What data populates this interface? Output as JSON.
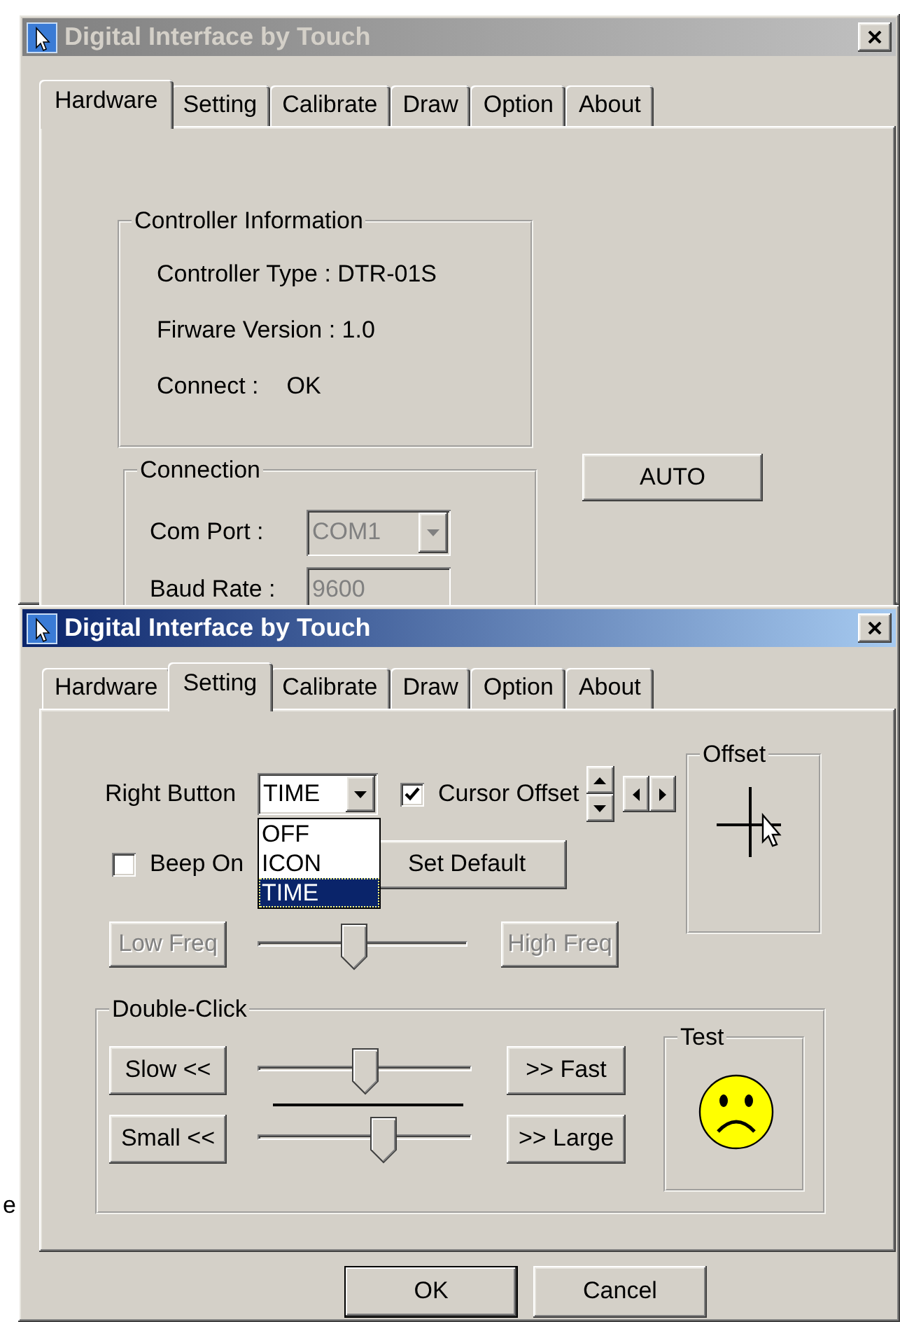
{
  "background_text": "e",
  "windows": [
    {
      "title": "Digital Interface by Touch",
      "active": false,
      "tabs": [
        {
          "label": "Hardware",
          "selected": true
        },
        {
          "label": "Setting",
          "selected": false
        },
        {
          "label": "Calibrate",
          "selected": false
        },
        {
          "label": "Draw",
          "selected": false
        },
        {
          "label": "Option",
          "selected": false
        },
        {
          "label": "About",
          "selected": false
        }
      ],
      "page": {
        "kind": "hardware",
        "controller_info": {
          "title": "Controller Information",
          "lines": [
            {
              "label": "Controller Type : DTR-01S"
            },
            {
              "label": "Firware Version : 1.0"
            },
            {
              "label": "Connect :",
              "value": "OK"
            }
          ]
        },
        "connection": {
          "title": "Connection",
          "fields": [
            {
              "label": "Com Port :",
              "value": "COM1",
              "kind": "combo",
              "disabled": true
            },
            {
              "label": "Baud Rate :",
              "value": "9600",
              "kind": "text",
              "disabled": true
            }
          ]
        },
        "auto_button": {
          "label": "AUTO"
        }
      }
    },
    {
      "title": "Digital Interface by Touch",
      "active": true,
      "tabs": [
        {
          "label": "Hardware",
          "selected": false
        },
        {
          "label": "Setting",
          "selected": true
        },
        {
          "label": "Calibrate",
          "selected": false
        },
        {
          "label": "Draw",
          "selected": false
        },
        {
          "label": "Option",
          "selected": false
        },
        {
          "label": "About",
          "selected": false
        }
      ],
      "page": {
        "kind": "setting",
        "right_button": {
          "label": "Right Button",
          "value": "TIME",
          "expanded": true,
          "options": [
            {
              "label": "OFF",
              "selected": false
            },
            {
              "label": "ICON",
              "selected": false
            },
            {
              "label": "TIME",
              "selected": true
            }
          ]
        },
        "cursor_offset": {
          "label": "Cursor Offset",
          "checked": true
        },
        "beep_on": {
          "label": "Beep On",
          "checked": false
        },
        "set_default": {
          "label": "Set Default"
        },
        "frequency": {
          "low": {
            "label": "Low Freq",
            "disabled": true
          },
          "high": {
            "label": "High Freq",
            "disabled": true
          },
          "level": 0.45
        },
        "offset_group": {
          "title": "Offset"
        },
        "double_click": {
          "title": "Double-Click",
          "rows": [
            {
              "left": {
                "label": "Slow <<",
                "disabled": false
              },
              "right": {
                "label": ">> Fast",
                "disabled": false
              },
              "level": 0.5
            },
            {
              "left": {
                "label": "Small <<",
                "disabled": false
              },
              "right": {
                "label": ">> Large",
                "disabled": false
              },
              "level": 0.6
            }
          ],
          "test": {
            "title": "Test"
          }
        }
      },
      "buttons": [
        {
          "label": "OK",
          "default": true
        },
        {
          "label": "Cancel",
          "default": false
        }
      ]
    }
  ]
}
